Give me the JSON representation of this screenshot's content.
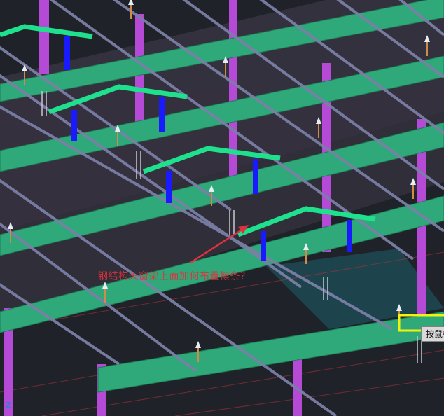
{
  "viewport": {
    "annotation_text": "钢结构天窗架上面加何布置檩条？",
    "tooltip_text": "按鼠标",
    "axis_label": "Z"
  },
  "colors": {
    "background": "#1f2228",
    "steel_beam": "#2fa97a",
    "skylight_frame": "#1fe08c",
    "column": "#b44ad6",
    "post": "#1a1aff",
    "purlin": "#7b7fa6",
    "annotation": "#e0323c",
    "selection": "#f2f20a"
  },
  "icons": [
    "bolt-marker-icon",
    "arrow-pointer-icon"
  ]
}
